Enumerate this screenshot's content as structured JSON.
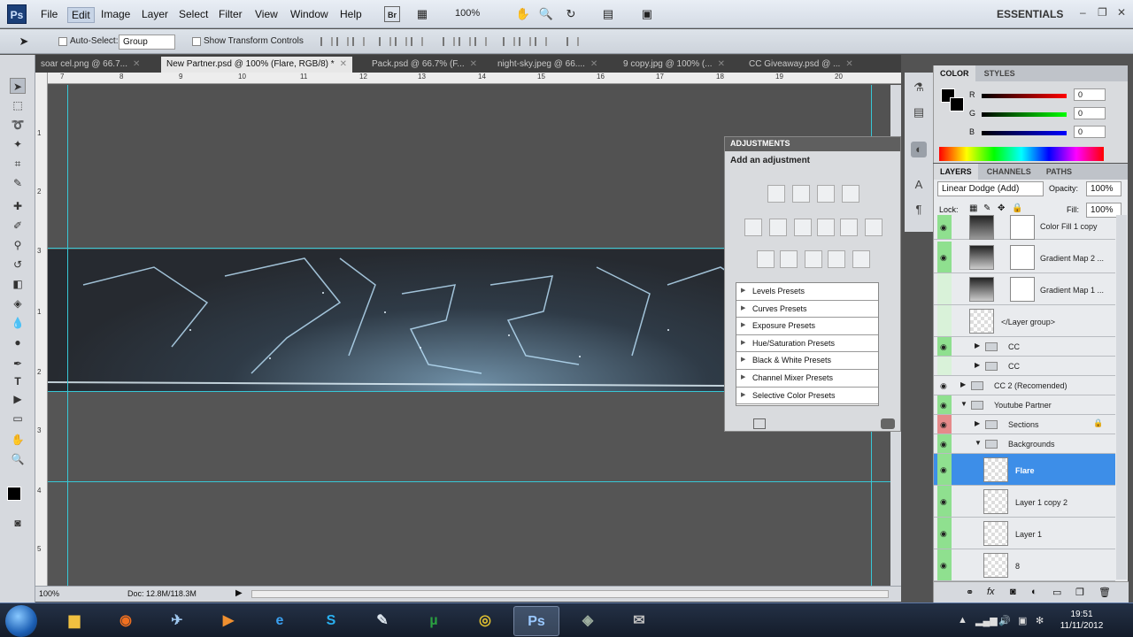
{
  "menubar": {
    "logo": "Ps",
    "items": [
      "File",
      "Edit",
      "Image",
      "Layer",
      "Select",
      "Filter",
      "View",
      "Window",
      "Help"
    ],
    "active_item": "Edit",
    "zoom": "100%",
    "workspace": "ESSENTIALS"
  },
  "options": {
    "auto_select_label": "Auto-Select:",
    "auto_select_value": "Group",
    "show_transform_label": "Show Transform Controls"
  },
  "tabs": [
    {
      "label": "soar cel.png @ 66.7..."
    },
    {
      "label": "New Partner.psd @ 100% (Flare, RGB/8) *"
    },
    {
      "label": "Pack.psd @ 66.7% (F..."
    },
    {
      "label": "night-sky.jpeg @ 66...."
    },
    {
      "label": "9 copy.jpg @ 100% (..."
    },
    {
      "label": "CC Giveaway.psd @ ..."
    }
  ],
  "ruler_h": [
    "7",
    "8",
    "9",
    "10",
    "11",
    "12",
    "13",
    "14",
    "15",
    "16",
    "17",
    "18",
    "19",
    "20"
  ],
  "ruler_v": [
    "1",
    "2",
    "3",
    "0",
    "1",
    "2",
    "3",
    "4",
    "5"
  ],
  "status": {
    "zoom": "100%",
    "doc": "Doc: 12.8M/118.3M"
  },
  "adjustments": {
    "title": "ADJUSTMENTS",
    "subtitle": "Add an adjustment",
    "presets": [
      "Levels Presets",
      "Curves Presets",
      "Exposure Presets",
      "Hue/Saturation Presets",
      "Black & White Presets",
      "Channel Mixer Presets",
      "Selective Color Presets"
    ]
  },
  "color_panel": {
    "tabs": [
      "COLOR",
      "STYLES"
    ],
    "r_label": "R",
    "g_label": "G",
    "b_label": "B",
    "r": "0",
    "g": "0",
    "b": "0"
  },
  "layers_panel": {
    "tabs": [
      "LAYERS",
      "CHANNELS",
      "PATHS"
    ],
    "blend_mode": "Linear Dodge (Add)",
    "opacity_label": "Opacity:",
    "opacity": "100%",
    "lock_label": "Lock:",
    "fill_label": "Fill:",
    "fill": "100%",
    "layers": [
      {
        "name": "Color Fill 1 copy"
      },
      {
        "name": "Gradient Map 2 ..."
      },
      {
        "name": "Gradient Map 1 ..."
      },
      {
        "name": "</Layer group>"
      },
      {
        "name": "CC"
      },
      {
        "name": "CC"
      },
      {
        "name": "CC 2 (Recomended)"
      },
      {
        "name": "Youtube Partner"
      },
      {
        "name": "Sections"
      },
      {
        "name": "Backgrounds"
      },
      {
        "name": "Flare"
      },
      {
        "name": "Layer 1 copy 2"
      },
      {
        "name": "Layer 1"
      },
      {
        "name": "8"
      }
    ]
  },
  "taskbar": {
    "time": "19:51",
    "date": "11/11/2012"
  },
  "colors": {
    "guide": "#37c7d6",
    "selected_layer": "#3d8ee8",
    "visibility": "#8fe08f"
  }
}
